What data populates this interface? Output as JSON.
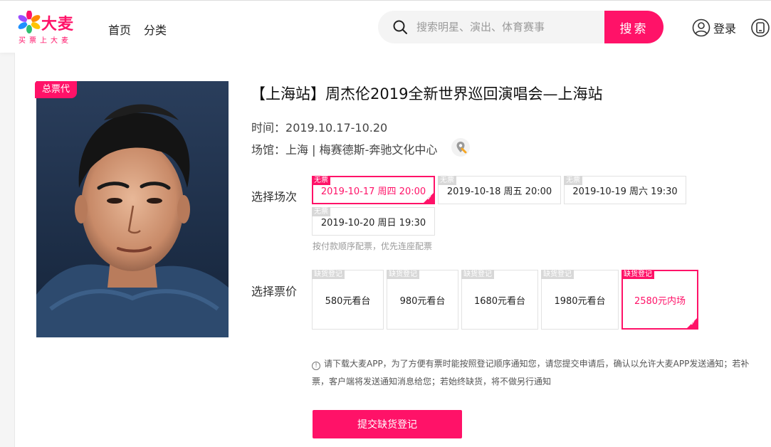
{
  "header": {
    "logo_text": "大麦",
    "logo_sub": "买票上大麦",
    "nav": [
      "首页",
      "分类"
    ],
    "search_placeholder": "搜索明星、演出、体育赛事",
    "search_button": "搜索",
    "login_label": "登录"
  },
  "event": {
    "badge": "总票代",
    "title": "【上海站】周杰伦2019全新世界巡回演唱会—上海站",
    "time_label": "时间：",
    "time_value": "2019.10.17-10.20",
    "venue_label": "场馆：",
    "venue_value": "上海 | 梅赛德斯-奔驰文化中心"
  },
  "sessions": {
    "label": "选择场次",
    "hint": "按付款顺序配票，优先连座配票",
    "options": [
      {
        "tag": "无票",
        "text": "2019-10-17 周四 20:00",
        "selected": true
      },
      {
        "tag": "无票",
        "text": "2019-10-18 周五 20:00",
        "selected": false
      },
      {
        "tag": "无票",
        "text": "2019-10-19 周六 19:30",
        "selected": false
      },
      {
        "tag": "无票",
        "text": "2019-10-20 周日 19:30",
        "selected": false
      }
    ]
  },
  "prices": {
    "label": "选择票价",
    "options": [
      {
        "tag": "缺货登记",
        "text": "580元看台",
        "selected": false
      },
      {
        "tag": "缺货登记",
        "text": "980元看台",
        "selected": false
      },
      {
        "tag": "缺货登记",
        "text": "1680元看台",
        "selected": false
      },
      {
        "tag": "缺货登记",
        "text": "1980元看台",
        "selected": false
      },
      {
        "tag": "缺货登记",
        "text": "2580元内场",
        "selected": true
      }
    ]
  },
  "notice": {
    "icon": "!",
    "text": "请下载大麦APP，为了方便有票时能按照登记顺序通知您，请您提交申请后，确认以允许大麦APP发送通知；若补票，客户端将发送通知消息给您；若始终缺货，将不做另行通知"
  },
  "submit_button": "提交缺货登记",
  "colors": {
    "accent": "#ff1268",
    "muted": "#d8d8d8"
  },
  "icons": [
    "damai-flower-icon",
    "search-icon",
    "user-icon",
    "more-icon",
    "location-pin-icon",
    "check-icon",
    "info-icon"
  ]
}
